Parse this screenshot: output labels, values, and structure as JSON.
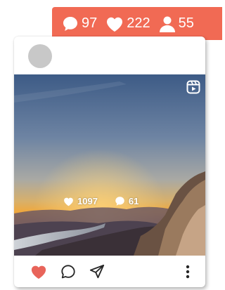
{
  "notification": {
    "comments": "97",
    "likes": "222",
    "followers": "55"
  },
  "post": {
    "overlay_likes": "1097",
    "overlay_comments": "61"
  },
  "colors": {
    "accent": "#f16a54",
    "avatar": "#c8c8c8",
    "like": "#e8645a",
    "icon": "#262626"
  },
  "icons": [
    "comment-icon",
    "heart-icon",
    "user-icon",
    "reel-icon",
    "share-icon",
    "more-icon"
  ]
}
